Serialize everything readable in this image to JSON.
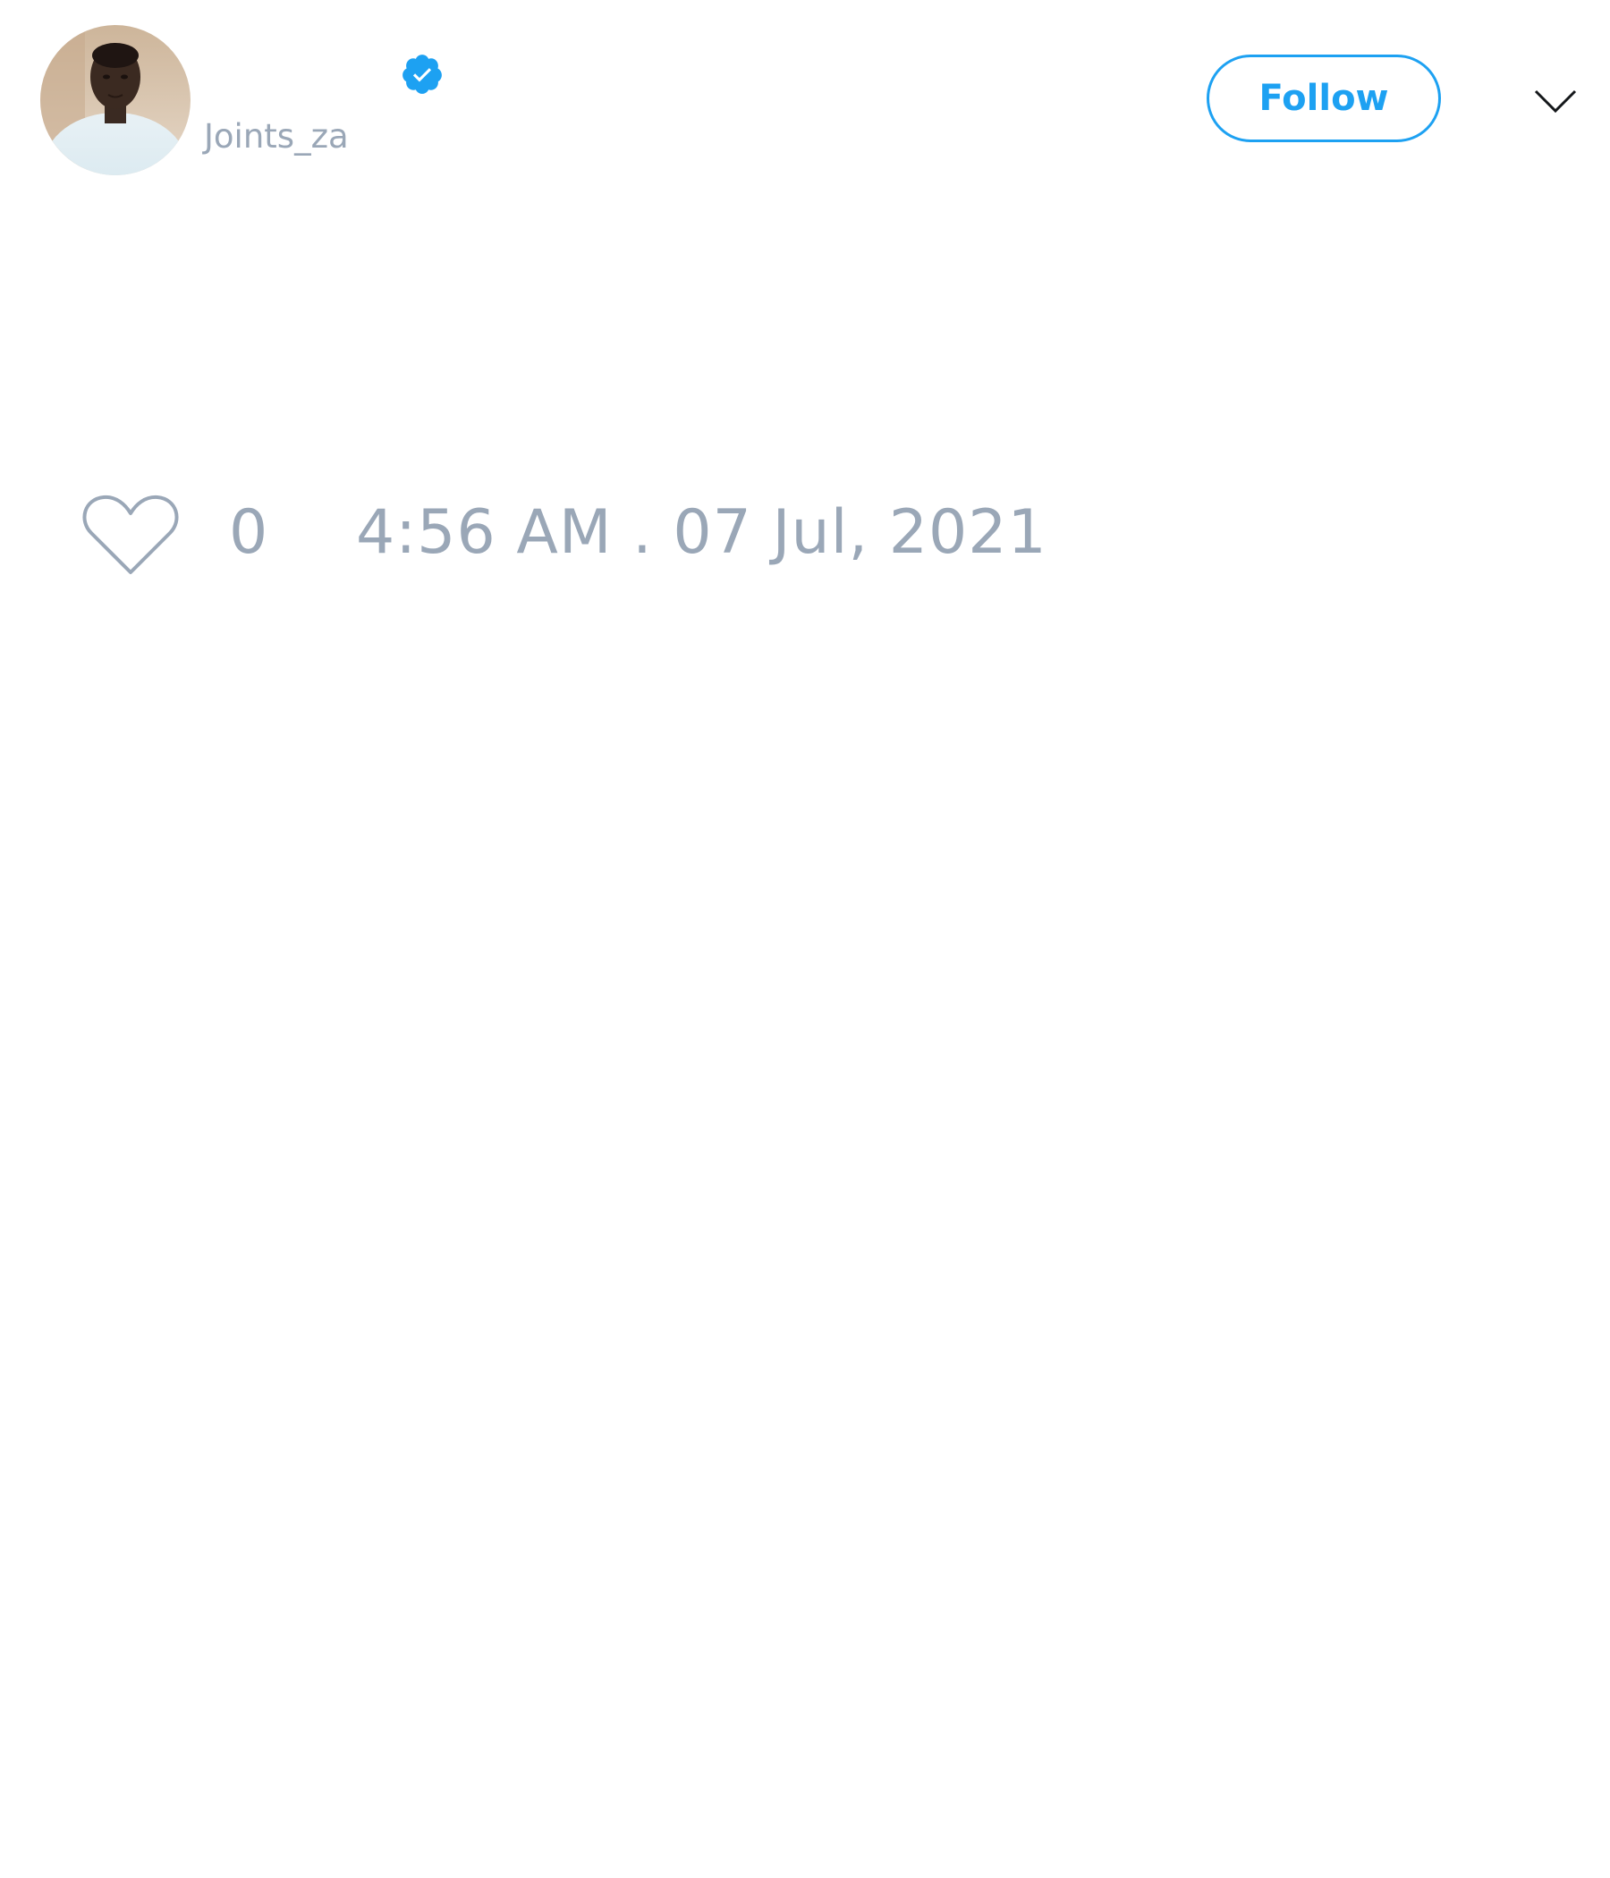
{
  "tweet": {
    "author": {
      "display_name": "",
      "handle": "Joints_za",
      "verified": true,
      "avatar_icon": "user-photo-avatar"
    },
    "follow_button": {
      "label": "Follow"
    },
    "menu_icon": "chevron-down-icon",
    "like": {
      "icon": "heart-icon",
      "count": "0"
    },
    "timestamp": "4:56 AM . 07 Jul, 2021"
  },
  "colors": {
    "accent": "#1da1f2",
    "muted_text": "#9aa7b7",
    "background": "#ffffff"
  }
}
